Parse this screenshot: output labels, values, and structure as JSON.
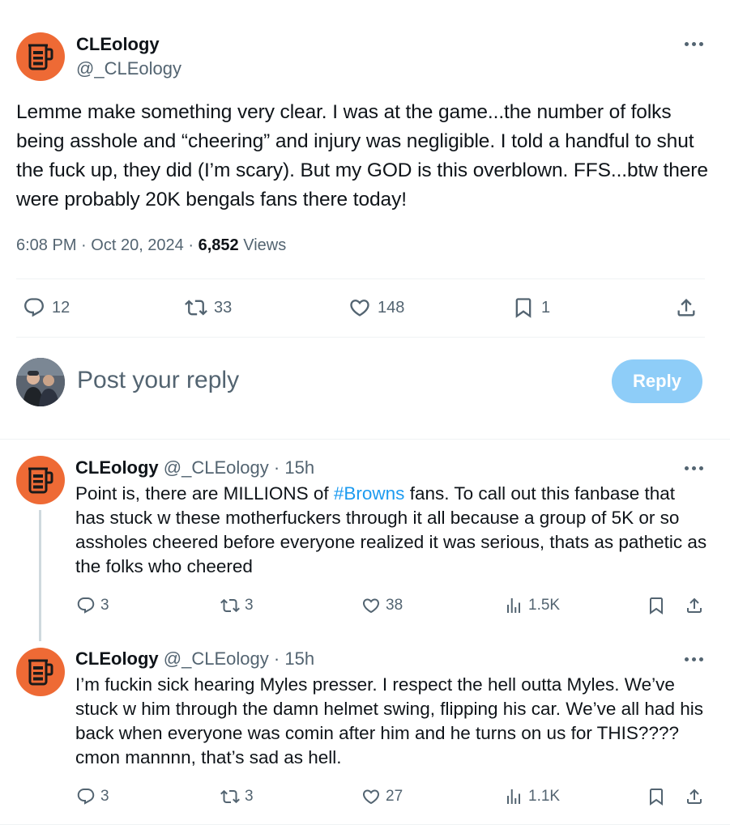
{
  "main_tweet": {
    "author_name": "CLEology",
    "author_handle": "@_CLEology",
    "text": "Lemme make something very clear. I was at the game...the number of folks being asshole and “cheering” and injury was negligible. I told a handful to shut the fuck up, they did (I’m scary). But my GOD is this overblown. FFS...btw there were probably 20K bengals fans there today!",
    "time": "6:08 PM",
    "date": "Oct 20, 2024",
    "views_count": "6,852",
    "views_label": "Views",
    "replies": "12",
    "reposts": "33",
    "likes": "148",
    "bookmarks": "1"
  },
  "composer": {
    "placeholder": "Post your reply",
    "reply_button": "Reply"
  },
  "replies": [
    {
      "author_name": "CLEology",
      "author_handle": "@_CLEology",
      "age": "15h",
      "text_before": "Point is, there are MILLIONS of ",
      "hashtag": "#Browns",
      "text_after": " fans. To call out this fanbase that has stuck w these motherfuckers through it all because a group of 5K or so assholes cheered before everyone realized it was serious, thats as pathetic as the folks who cheered",
      "replies": "3",
      "reposts": "3",
      "likes": "38",
      "views": "1.5K"
    },
    {
      "author_name": "CLEology",
      "author_handle": "@_CLEology",
      "age": "15h",
      "text": "I’m fuckin sick hearing Myles presser. I respect the hell outta Myles. We’ve stuck w him through the damn helmet swing, flipping his car. We’ve all had his back when everyone was comin after him and he turns on us for THIS???? cmon mannnn, that’s sad as hell.",
      "replies": "3",
      "reposts": "3",
      "likes": "27",
      "views": "1.1K"
    }
  ],
  "sep": "·",
  "colors": {
    "brand_orange": "#ee6a35",
    "link_blue": "#1d9bf0",
    "reply_button_disabled": "#8ecdf8",
    "secondary_text": "#536471"
  }
}
